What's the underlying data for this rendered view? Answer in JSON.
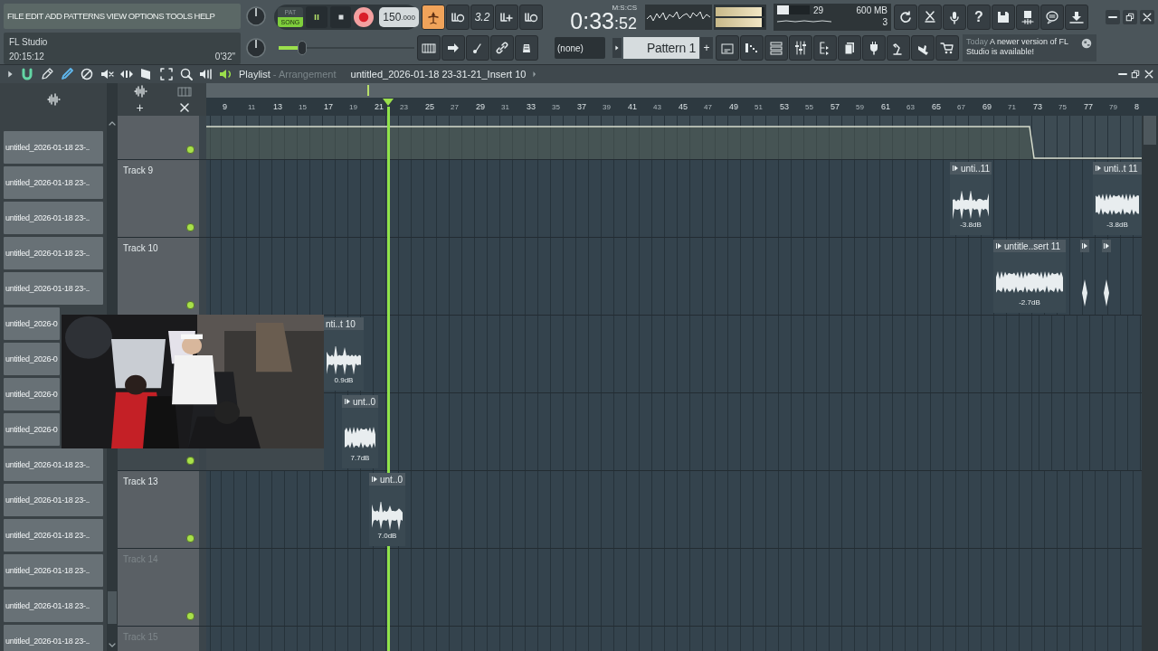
{
  "menu": [
    "FILE",
    "EDIT",
    "ADD",
    "PATTERNS",
    "VIEW",
    "OPTIONS",
    "TOOLS",
    "HELP"
  ],
  "hint_panel": {
    "title": "FL Studio",
    "clock": "20:15:12",
    "duration": "0'32\""
  },
  "transport": {
    "modes": [
      {
        "label": "PAT",
        "selected": false
      },
      {
        "label": "SONG",
        "selected": true
      }
    ],
    "tempo": "150",
    "tempo_fraction": ".000"
  },
  "master_slider": {
    "level": 0.17
  },
  "record_tools": [
    {
      "on": true
    },
    {
      "on": false
    },
    {
      "label": "3.2",
      "on": false
    },
    {
      "on": false
    },
    {
      "on": false
    }
  ],
  "time_display": {
    "format": "M:S:CS",
    "main": "0:33",
    "fraction": ":52"
  },
  "meters": [
    {
      "level": 0.95
    },
    {
      "level": 0.95
    }
  ],
  "cpu": {
    "level": 0.35,
    "reading": "29",
    "memory": "600 MB",
    "polyphony": "3"
  },
  "help_button": "?",
  "channel_selector": "(none)",
  "pattern_selector": {
    "value": "Pattern 1",
    "add": "+"
  },
  "news": {
    "date": "Today",
    "message": "A newer version of FL Studio is available!"
  },
  "playlist": {
    "title": "Playlist",
    "subtitle": "- Arrangement",
    "clip_name": "untitled_2026-01-18 23-31-21_Insert 10",
    "add_button": "+",
    "ruler": [
      "9",
      "11",
      "13",
      "15",
      "17",
      "19",
      "21",
      "23",
      "25",
      "27",
      "29",
      "31",
      "33",
      "35",
      "37",
      "39",
      "41",
      "43",
      "45",
      "47",
      "49",
      "51",
      "53",
      "55",
      "57",
      "59",
      "61",
      "63",
      "65",
      "67",
      "69",
      "71",
      "73",
      "75",
      "77",
      "79",
      "8"
    ],
    "clip_sources": [
      "untitled_2026-01-18 23-..",
      "untitled_2026-01-18 23-..",
      "untitled_2026-01-18 23-..",
      "untitled_2026-01-18 23-..",
      "untitled_2026-01-18 23-..",
      "untitled_2026-0",
      "untitled_2026-0",
      "untitled_2026-0",
      "untitled_2026-0",
      "untitled_2026-01-18 23-..",
      "untitled_2026-01-18 23-..",
      "untitled_2026-01-18 23-..",
      "untitled_2026-01-18 23-..",
      "untitled_2026-01-18 23-..",
      "untitled_2026-01-18 23-.."
    ],
    "tracks": [
      {
        "kind": "automation"
      },
      {
        "kind": "audio",
        "name": "Track 9",
        "disabled": false,
        "clips": [
          {
            "kind": "audio",
            "label": "unti..11",
            "gain": "-3.8dB"
          },
          {
            "kind": "audio",
            "label": "unti..t 11",
            "gain": "-3.8dB"
          }
        ]
      },
      {
        "kind": "audio",
        "name": "Track 10",
        "disabled": false,
        "clips": [
          {
            "kind": "audio",
            "label": "untitle..sert 11",
            "gain": "-2.7dB"
          },
          {
            "kind": "short"
          },
          {
            "kind": "short"
          }
        ]
      },
      {
        "kind": "audio",
        "clips": [
          {
            "kind": "covered",
            "label": "nti..t 10",
            "gain": "0.9dB"
          }
        ]
      },
      {
        "kind": "audio",
        "clips": [
          {
            "kind": "audio",
            "label": "unt..0",
            "gain": "7.7dB"
          }
        ]
      },
      {
        "kind": "audio",
        "name": "Track 13",
        "disabled": false,
        "clips": [
          {
            "kind": "audio",
            "label": "unt..0",
            "gain": "7.0dB"
          }
        ]
      },
      {
        "kind": "audio",
        "name": "Track 14",
        "disabled": true
      },
      {
        "kind": "audio",
        "name": "Track 15",
        "disabled": true
      }
    ]
  }
}
